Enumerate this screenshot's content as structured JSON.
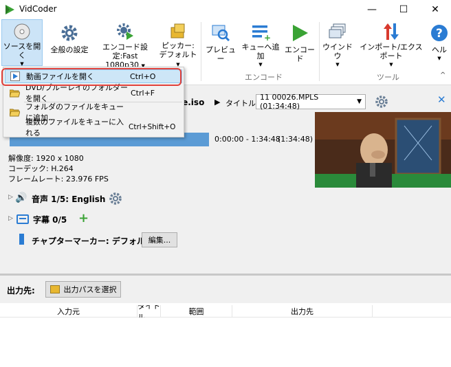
{
  "window": {
    "title": "VidCoder",
    "minimize": "—",
    "maximize": "☐",
    "close": "✕"
  },
  "ribbon": {
    "source_open": "ソースを開く",
    "general_settings": "全般の設定",
    "encode_settings_line1": "エンコード設定:Fast",
    "encode_settings_line2": "1080p30",
    "picker_line1": "ピッカー:",
    "picker_line2": "デフォルト",
    "preview": "プレビュー",
    "add_to_queue": "キューへ追加",
    "encode": "エンコード",
    "window": "ウインドウ",
    "import_export": "インポート/エクスポート",
    "help": "ヘル",
    "group_encode": "エンコード",
    "group_tools": "ツール"
  },
  "menu": {
    "items": [
      {
        "label": "動画ファイルを開く",
        "shortcut": "Ctrl+O"
      },
      {
        "label": "DVD/ブルーレイのフォルダーを開く",
        "shortcut": "Ctrl+F"
      },
      {
        "label": "フォルダのファイルをキューに追加...",
        "shortcut": ""
      },
      {
        "label": "複数のファイルをキューに入れる",
        "shortcut": "Ctrl+Shift+O"
      }
    ]
  },
  "source": {
    "filename_suffix": "le.iso",
    "title_label": "タイトル:",
    "title_value": "11 00026.MPLS (01:34:48)",
    "range": "0:00:00 - 1:34:48",
    "duration": "(1:34:48)",
    "resolution": "解像度: 1920 x 1080",
    "codec": "コーデック: H.264",
    "framerate": "フレームレート: 23.976 FPS"
  },
  "tracks": {
    "audio_label": "音声 1/5: English",
    "subtitle_label": "字幕 0/5",
    "chapter_label": "チャプターマーカー: デフォルト",
    "edit_button": "編集..."
  },
  "output": {
    "label": "出力先:",
    "choose_path": "出力パスを選択"
  },
  "queue_columns": [
    "入力元",
    "タイトル",
    "範囲",
    "出力先"
  ],
  "colors": {
    "accent_blue": "#2b7cd3",
    "active_bg": "#cce4f7",
    "highlight_ring": "#e0403a",
    "progress_bar": "#5b9bd5"
  }
}
